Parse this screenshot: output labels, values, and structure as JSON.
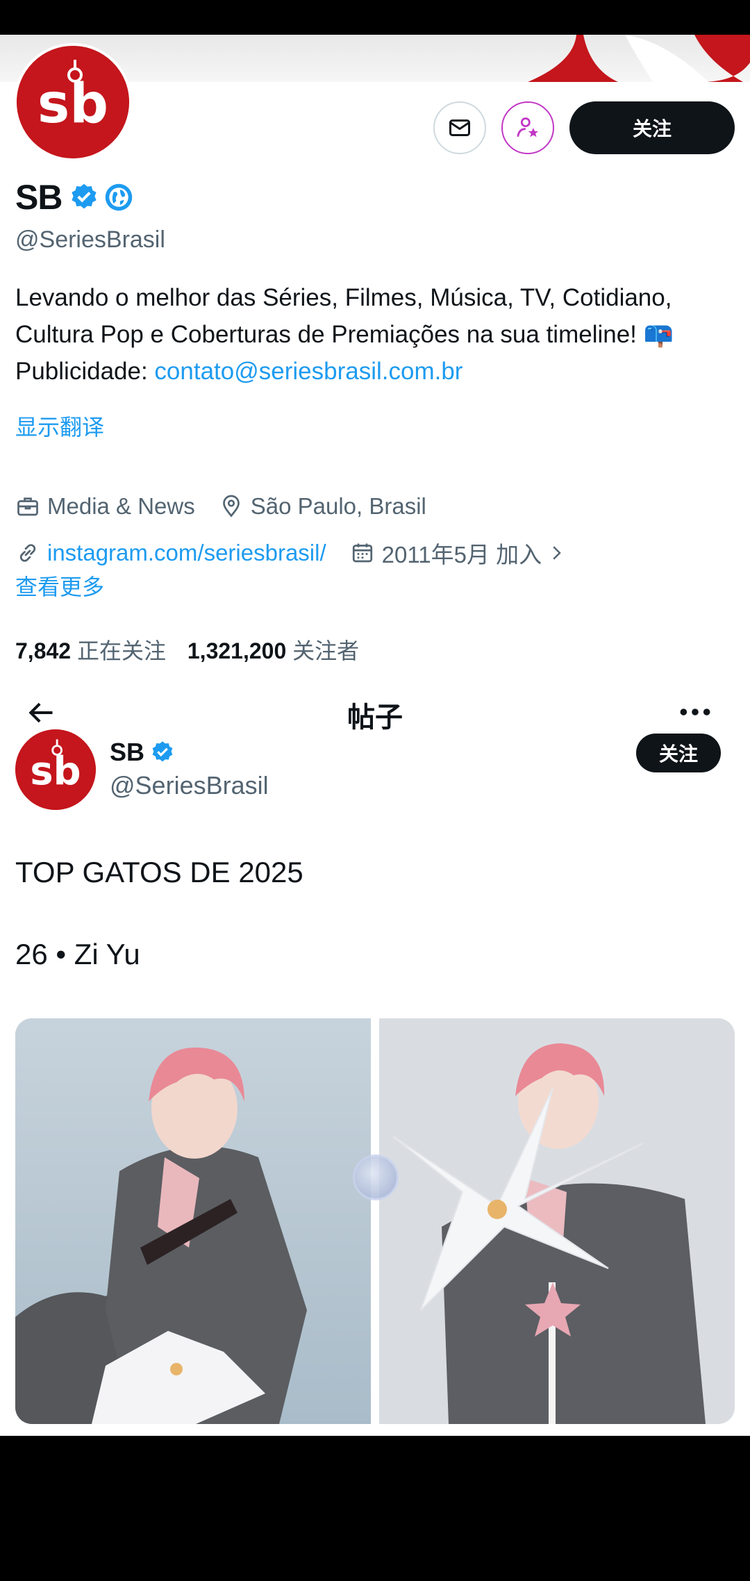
{
  "profile": {
    "display_name": "SB",
    "handle": "@SeriesBrasil",
    "follow_label": "关注",
    "bio_text": "Levando o melhor das Séries, Filmes, Música, TV, Cotidiano, Cultura Pop e Coberturas de Premiações na sua timeline! 📪 Publicidade: ",
    "bio_link": "contato@seriesbrasil.com.br",
    "translate_label": "显示翻译",
    "category": "Media & News",
    "location": "São Paulo, Brasil",
    "website": "instagram.com/seriesbrasil/",
    "joined": "2011年5月 加入",
    "show_more_label": "查看更多",
    "following_count": "7,842",
    "following_label": "正在关注",
    "followers_count": "1,321,200",
    "followers_label": "关注者",
    "logo_text": "sb"
  },
  "nav": {
    "title": "帖子"
  },
  "post": {
    "author_name": "SB",
    "author_handle": "@SeriesBrasil",
    "follow_label": "关注",
    "text_line1": "TOP GATOS DE 2025",
    "text_line2": "26 • Zi Yu"
  },
  "colors": {
    "brand_red": "#c4161c",
    "link_blue": "#1d9bf0",
    "button_dark": "#0f1419",
    "muted_text": "#536471"
  },
  "icons": [
    "mail-icon",
    "subscribe-star-icon",
    "verified-badge-icon",
    "globe-badge-icon",
    "briefcase-icon",
    "location-pin-icon",
    "link-icon",
    "calendar-icon",
    "chevron-right-icon",
    "back-arrow-icon",
    "more-icon"
  ]
}
